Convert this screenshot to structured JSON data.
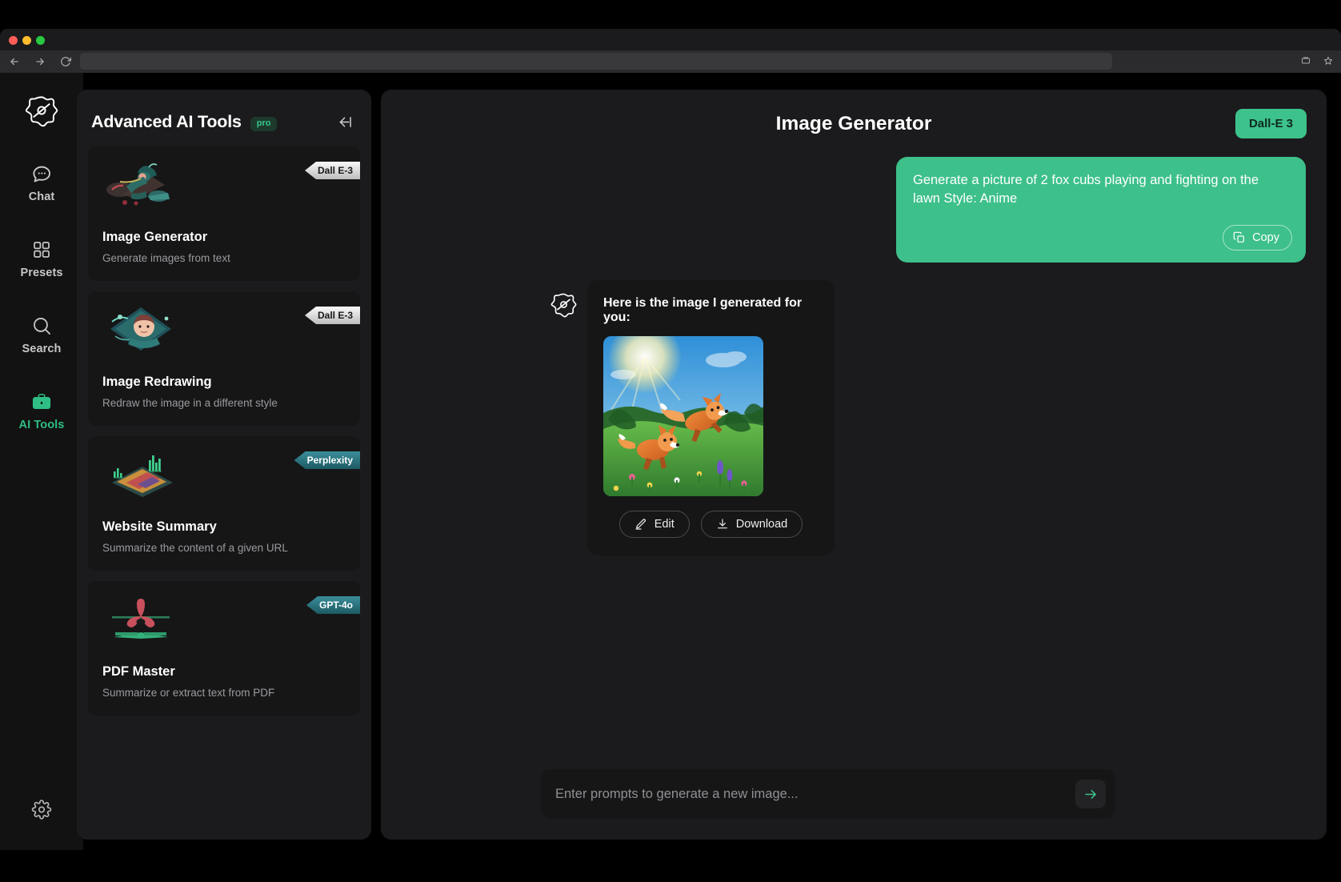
{
  "browser": {
    "back_icon": "back-arrow-icon",
    "forward_icon": "forward-arrow-icon",
    "reload_icon": "reload-icon",
    "extensions_icon": "extensions-icon",
    "bookmark_icon": "bookmark-star-icon",
    "url_value": "",
    "url_placeholder": ""
  },
  "rail": {
    "logo_icon": "app-logo-icon",
    "items": [
      {
        "label": "Chat",
        "icon": "chat-bubble-icon",
        "active": false
      },
      {
        "label": "Presets",
        "icon": "grid-squares-icon",
        "active": false
      },
      {
        "label": "Search",
        "icon": "magnifier-icon",
        "active": false
      },
      {
        "label": "AI Tools",
        "icon": "briefcase-icon",
        "active": true
      }
    ],
    "settings_icon": "gear-icon"
  },
  "tools_panel": {
    "title": "Advanced AI Tools",
    "pro_badge": "pro",
    "collapse_icon": "collapse-left-icon",
    "cards": [
      {
        "name": "Image Generator",
        "desc": "Generate images from text",
        "badge": "Dall E-3",
        "badge_style": "silver",
        "thumb": "witch-on-broom-thumbnail"
      },
      {
        "name": "Image Redrawing",
        "desc": "Redraw the image in a different style",
        "badge": "Dall E-3",
        "badge_style": "silver",
        "thumb": "portrait-restyle-thumbnail"
      },
      {
        "name": "Website Summary",
        "desc": "Summarize the content of a given URL",
        "badge": "Perplexity",
        "badge_style": "teal",
        "thumb": "data-chart-thumbnail"
      },
      {
        "name": "PDF Master",
        "desc": "Summarize or extract text from PDF",
        "badge": "GPT-4o",
        "badge_style": "teal",
        "thumb": "pdf-acrobat-thumbnail"
      }
    ]
  },
  "main": {
    "title": "Image Generator",
    "model_pill": "Dall-E 3",
    "user_message": "Generate a picture of 2 fox cubs playing and fighting on the lawn Style: Anime",
    "copy_label": "Copy",
    "copy_icon": "copy-icon",
    "bot_avatar_icon": "app-logo-icon",
    "bot_message": "Here is the image I generated for you:",
    "generated_image_alt": "two anime fox cubs playing on a sunlit lawn",
    "edit_label": "Edit",
    "edit_icon": "pencil-icon",
    "download_label": "Download",
    "download_icon": "download-icon",
    "composer_placeholder": "Enter prompts to generate a new image...",
    "composer_value": "",
    "send_icon": "arrow-right-icon"
  },
  "colors": {
    "accent_green": "#3dc28c",
    "bubble_green": "#3dc08a",
    "panel_bg": "#1b1b1d",
    "card_bg": "#161617",
    "badge_teal": "#3b8e9a",
    "app_bg": "#000000"
  }
}
